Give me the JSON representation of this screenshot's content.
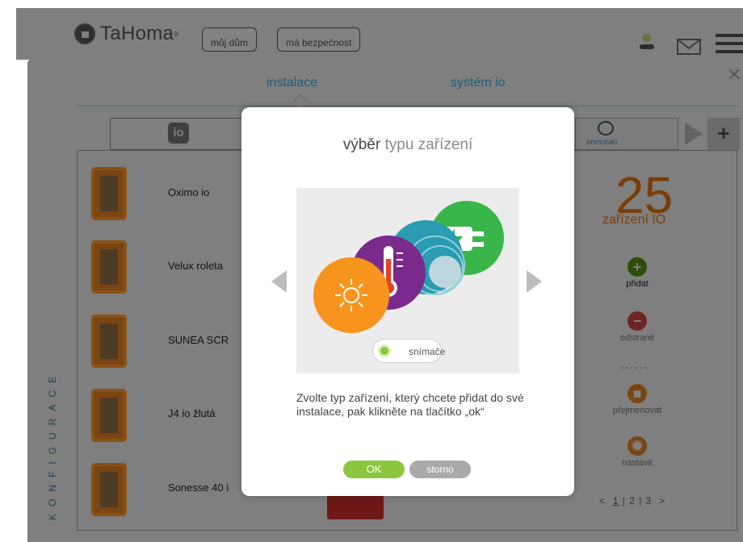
{
  "header": {
    "app_name": "TaHoma",
    "registered_mark": "®",
    "buttons": [
      "můj dům",
      "má bezpečnost"
    ]
  },
  "config": {
    "tabs": [
      "instalace",
      "systém io"
    ],
    "brands": {
      "io": "io",
      "enocean": "enocean"
    },
    "devices": [
      {
        "label": "Oximo io",
        "icon": "roller-shutter-icon"
      },
      {
        "label": "Velux roleta",
        "icon": "roof-blind-icon"
      },
      {
        "label": "SUNEA SCR",
        "icon": "screen-icon"
      },
      {
        "label": "J4 io žlutá",
        "icon": "venetian-blind-icon"
      },
      {
        "label": "Sonesse 40 i",
        "icon": "blind-icon"
      }
    ],
    "vertical_label": "KONFIGURACE",
    "device_count": "25",
    "device_count_label": "zařízení IO",
    "actions": {
      "add": "přidat",
      "remove": "odstranit",
      "separator": "------",
      "rename": "přejmenovat",
      "settings": "nastavit"
    },
    "pager": {
      "prev": "<",
      "pages": [
        "1",
        "2",
        "3"
      ],
      "next": ">",
      "current": "1"
    }
  },
  "modal": {
    "title_bold": "výběr",
    "title_rest": "typu zařízení",
    "option_label": "snímače",
    "description": "Zvolte typ zařízení, který chcete přidat do své instalace, pak klikněte na tlačítko „ok“",
    "ok_label": "OK",
    "cancel_label": "storno"
  },
  "colors": {
    "accent_green": "#8cc63f",
    "sun_orange": "#f7941d",
    "temp_purple": "#7a2a8c",
    "wave_teal": "#2a9bb0",
    "plug_green": "#39b54a"
  }
}
